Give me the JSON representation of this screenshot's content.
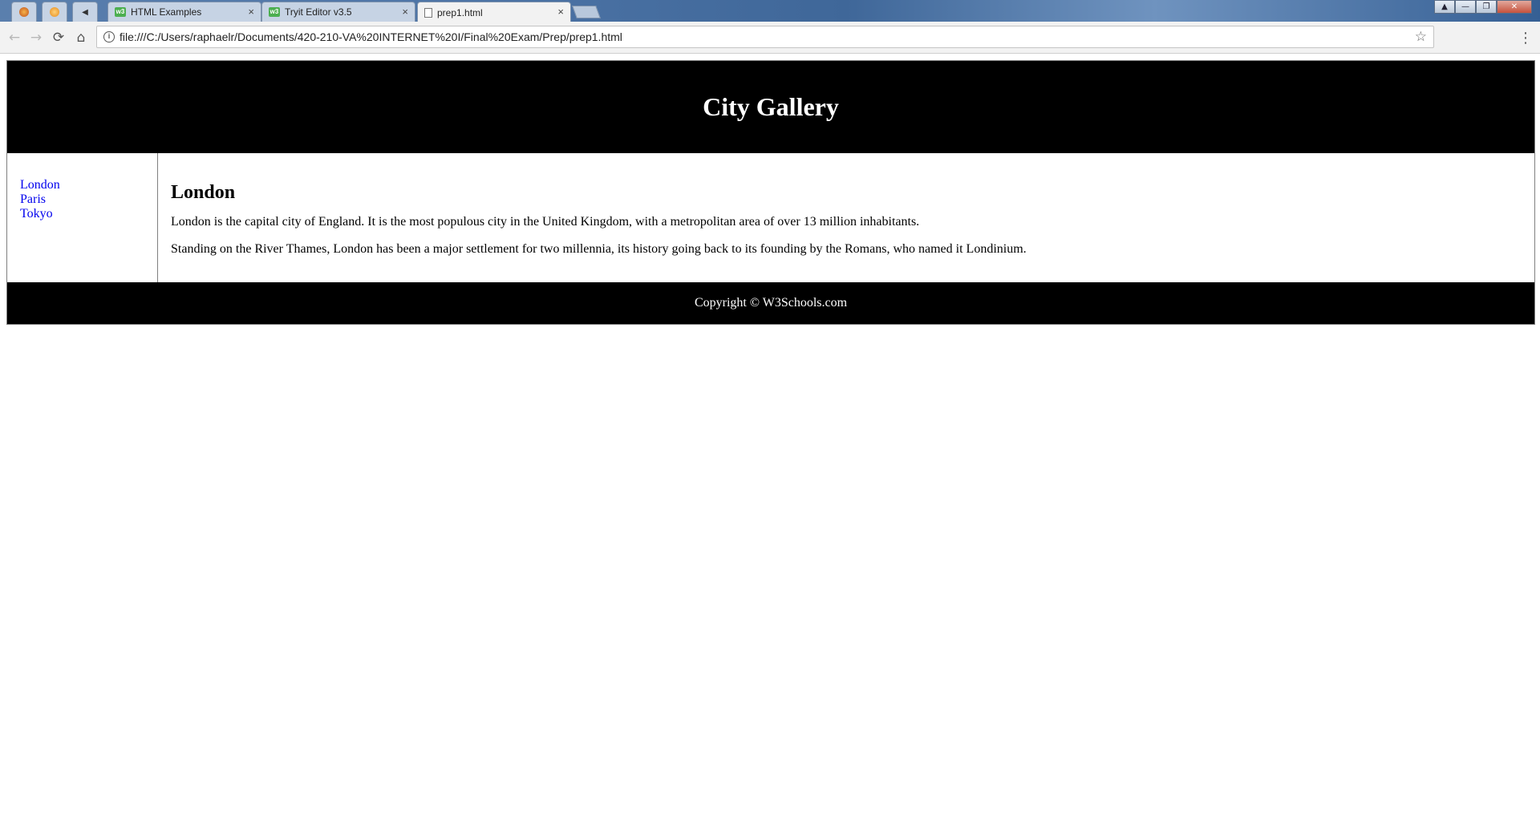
{
  "browser": {
    "tabs": [
      {
        "label": "HTML Examples",
        "icon": "w3schools-icon"
      },
      {
        "label": "Tryit Editor v3.5",
        "icon": "w3schools-icon"
      },
      {
        "label": "prep1.html",
        "icon": "document-icon"
      }
    ],
    "address_bar": {
      "url": "file:///C:/Users/raphaelr/Documents/420-210-VA%20INTERNET%20I/Final%20Exam/Prep/prep1.html"
    },
    "icons": {
      "close": "×",
      "back": "←",
      "forward": "→",
      "reload": "⟳",
      "home": "⌂",
      "info": "i",
      "star": "☆",
      "menu": "⋮",
      "minimize": "—",
      "maximize": "❐",
      "window_close": "✕",
      "user": "▲"
    }
  },
  "page": {
    "header_title": "City Gallery",
    "nav_links": [
      "London",
      "Paris",
      "Tokyo"
    ],
    "article": {
      "heading": "London",
      "paragraphs": [
        "London is the capital city of England. It is the most populous city in the United Kingdom, with a metropolitan area of over 13 million inhabitants.",
        "Standing on the River Thames, London has been a major settlement for two millennia, its history going back to its founding by the Romans, who named it Londinium."
      ]
    },
    "footer_text": "Copyright © W3Schools.com"
  },
  "colors": {
    "header_bg": "#000000",
    "link": "#0000ee",
    "titlebar": "#4d74a6"
  }
}
